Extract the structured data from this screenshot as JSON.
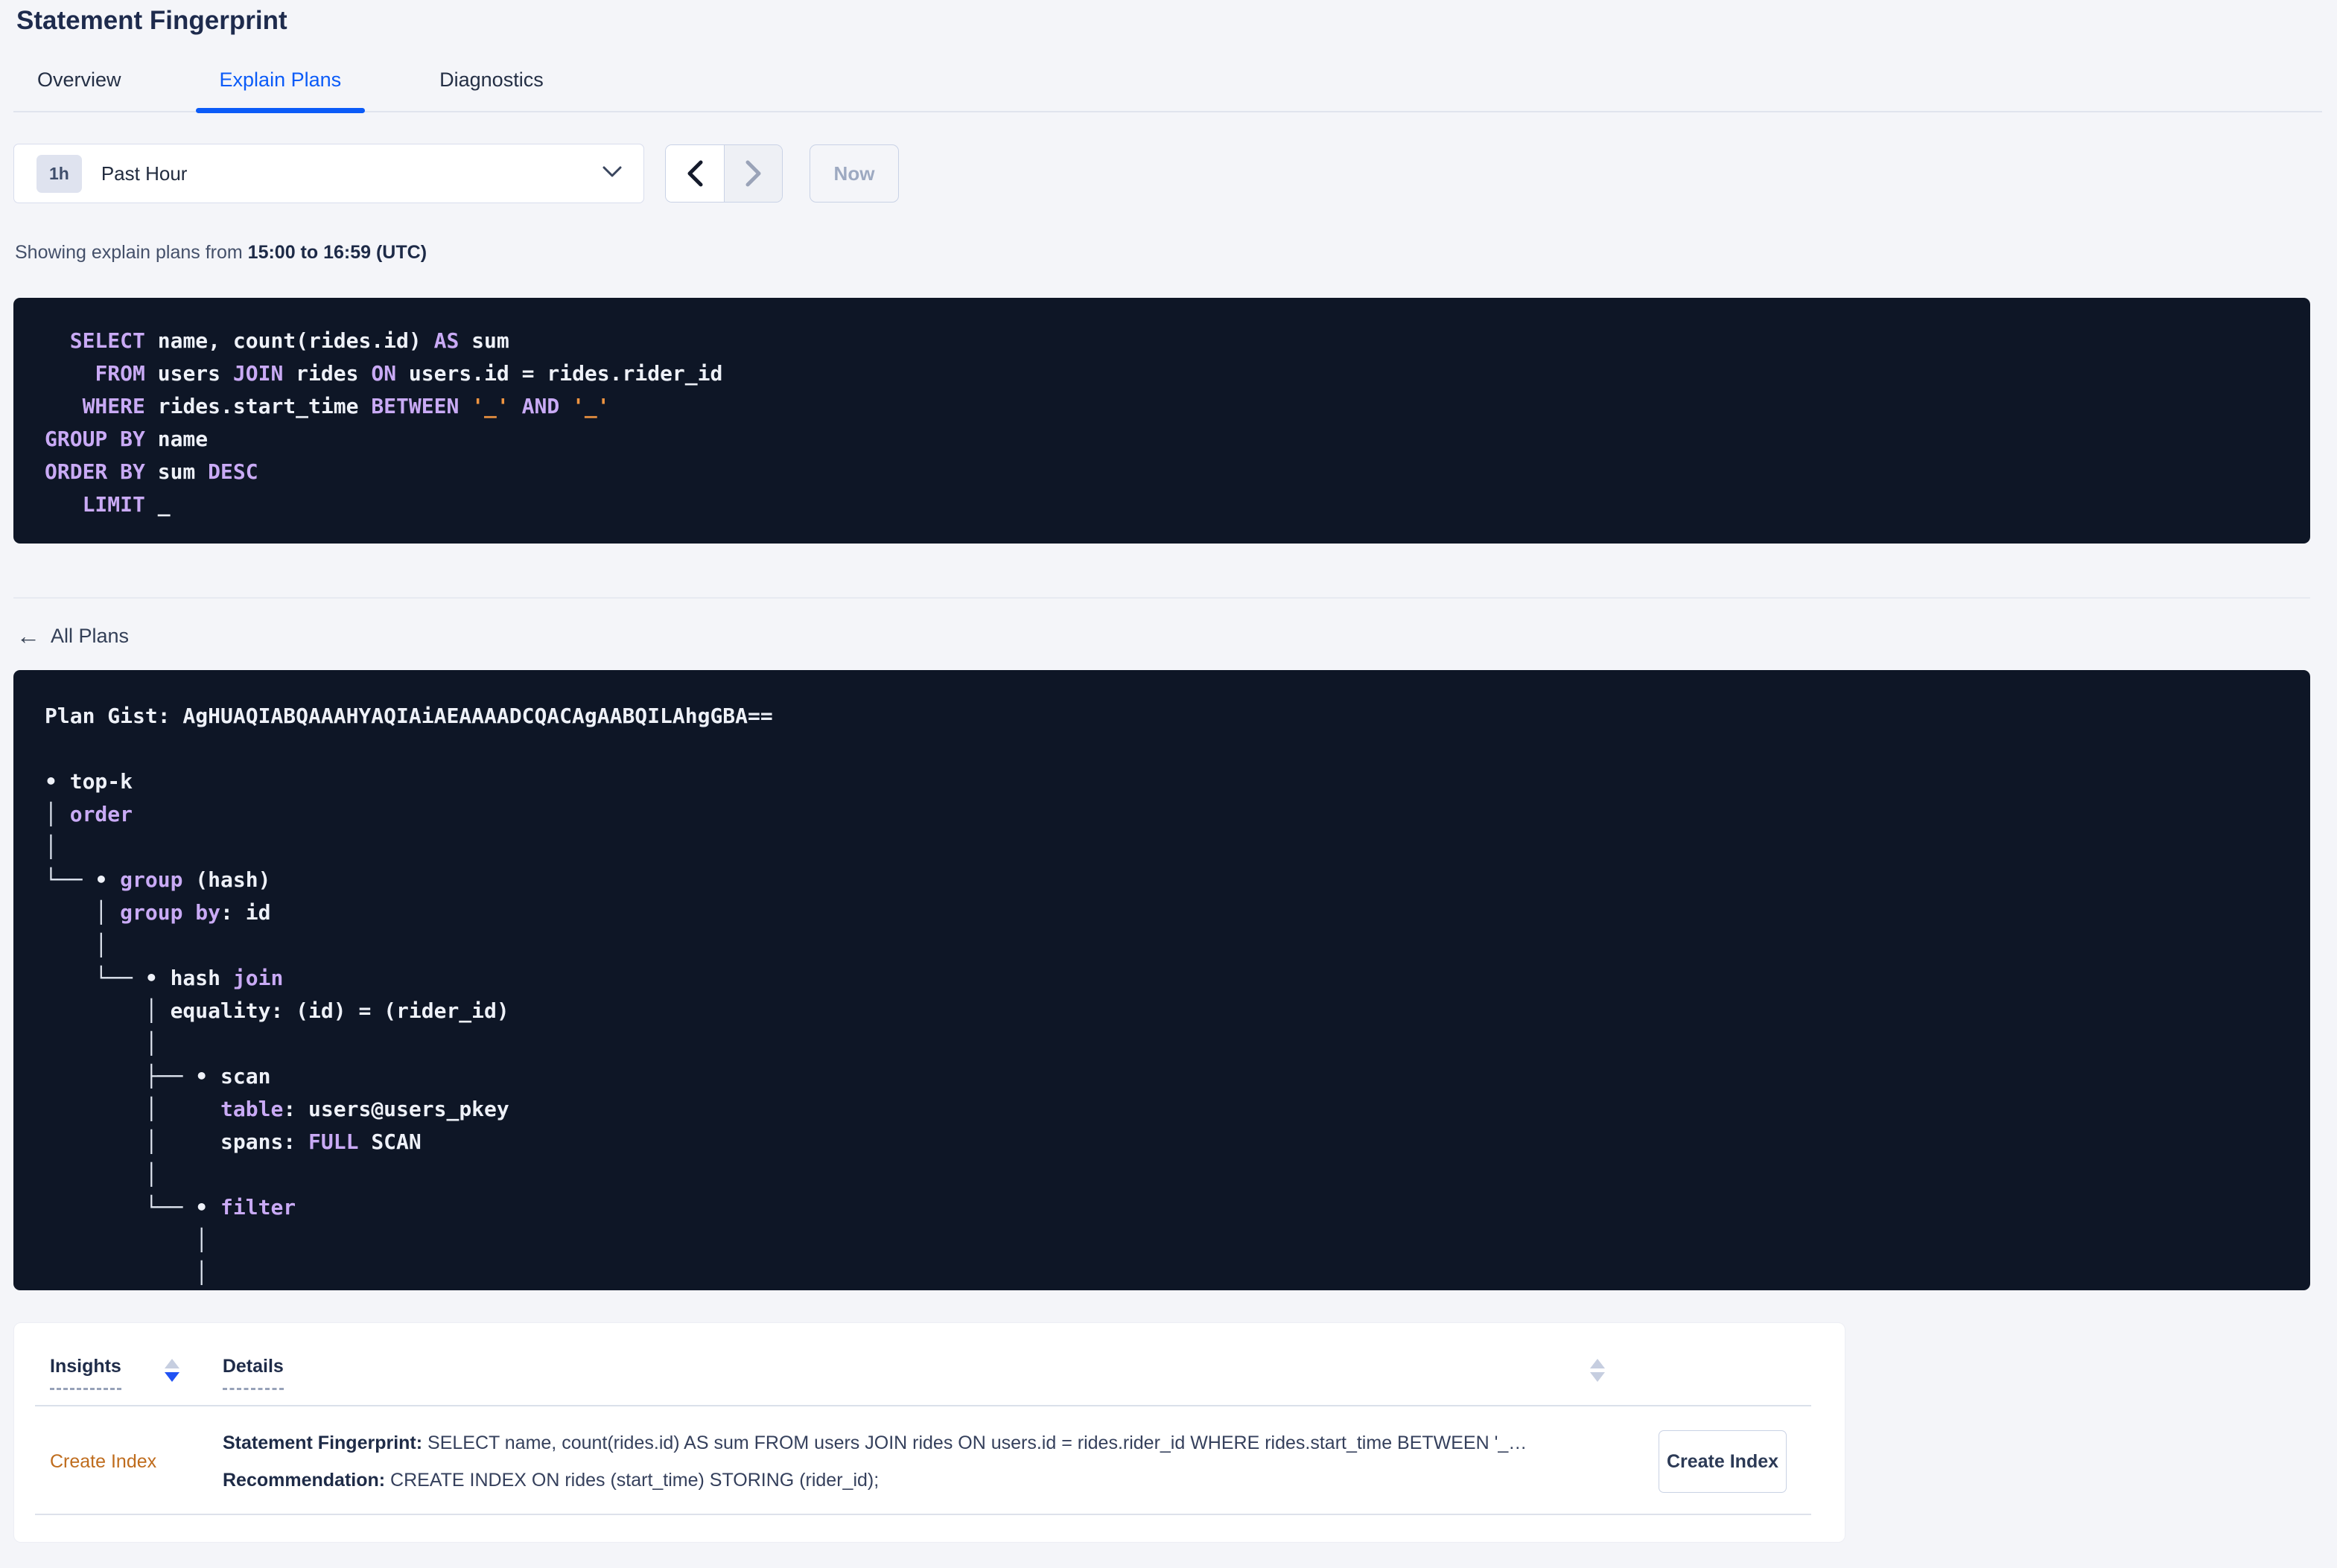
{
  "page": {
    "title": "Statement Fingerprint"
  },
  "tabs": [
    {
      "label": "Overview",
      "active": false
    },
    {
      "label": "Explain Plans",
      "active": true
    },
    {
      "label": "Diagnostics",
      "active": false
    }
  ],
  "time_selector": {
    "interval_badge": "1h",
    "selected_label": "Past Hour"
  },
  "nav": {
    "now_label": "Now"
  },
  "showing": {
    "prefix": "Showing explain plans from ",
    "range": "15:00 to 16:59 (UTC)"
  },
  "colors": {
    "accent_blue": "#0b5bf8",
    "keyword_purple": "#c9aaf5",
    "literal_orange": "#ef9440",
    "insight_orange": "#bf6c1d",
    "code_bg": "#0e1626"
  },
  "sql_block": {
    "lines": [
      [
        {
          "t": "  ",
          "c": "p"
        },
        {
          "t": "SELECT",
          "c": "k"
        },
        {
          "t": " name, count(rides.id) ",
          "c": "p"
        },
        {
          "t": "AS",
          "c": "k"
        },
        {
          "t": " sum",
          "c": "p"
        }
      ],
      [
        {
          "t": "    ",
          "c": "p"
        },
        {
          "t": "FROM",
          "c": "k"
        },
        {
          "t": " users ",
          "c": "p"
        },
        {
          "t": "JOIN",
          "c": "k"
        },
        {
          "t": " rides ",
          "c": "p"
        },
        {
          "t": "ON",
          "c": "k"
        },
        {
          "t": " users.id = rides.rider_id",
          "c": "p"
        }
      ],
      [
        {
          "t": "   ",
          "c": "p"
        },
        {
          "t": "WHERE",
          "c": "k"
        },
        {
          "t": " rides.start_time ",
          "c": "p"
        },
        {
          "t": "BETWEEN",
          "c": "k"
        },
        {
          "t": " ",
          "c": "p"
        },
        {
          "t": "'_'",
          "c": "o"
        },
        {
          "t": " ",
          "c": "p"
        },
        {
          "t": "AND",
          "c": "k"
        },
        {
          "t": " ",
          "c": "p"
        },
        {
          "t": "'_'",
          "c": "o"
        }
      ],
      [
        {
          "t": "GROUP BY",
          "c": "k"
        },
        {
          "t": " name",
          "c": "p"
        }
      ],
      [
        {
          "t": "ORDER BY",
          "c": "k"
        },
        {
          "t": " sum ",
          "c": "p"
        },
        {
          "t": "DESC",
          "c": "k"
        }
      ],
      [
        {
          "t": "   ",
          "c": "p"
        },
        {
          "t": "LIMIT",
          "c": "k"
        },
        {
          "t": " _",
          "c": "p"
        }
      ]
    ]
  },
  "all_plans": {
    "label": "All Plans",
    "arrow": "←"
  },
  "plan_block": {
    "lines": [
      [
        {
          "t": "Plan Gist: AgHUAQIABQAAAHYAQIAiAEAAAADCQACAgAABQILAhgGBA==",
          "c": "p"
        }
      ],
      [
        {
          "t": "",
          "c": "p"
        }
      ],
      [
        {
          "t": "• top-k",
          "c": "p"
        }
      ],
      [
        {
          "t": "│ ",
          "c": "t"
        },
        {
          "t": "order",
          "c": "k"
        }
      ],
      [
        {
          "t": "│",
          "c": "t"
        }
      ],
      [
        {
          "t": "└── ",
          "c": "t"
        },
        {
          "t": "• ",
          "c": "p"
        },
        {
          "t": "group",
          "c": "k"
        },
        {
          "t": " (hash)",
          "c": "p"
        }
      ],
      [
        {
          "t": "    │ ",
          "c": "t"
        },
        {
          "t": "group by",
          "c": "k"
        },
        {
          "t": ": id",
          "c": "p"
        }
      ],
      [
        {
          "t": "    │",
          "c": "t"
        }
      ],
      [
        {
          "t": "    └── ",
          "c": "t"
        },
        {
          "t": "• hash ",
          "c": "p"
        },
        {
          "t": "join",
          "c": "k"
        }
      ],
      [
        {
          "t": "        │ ",
          "c": "t"
        },
        {
          "t": "equality: (id) = (rider_id)",
          "c": "p"
        }
      ],
      [
        {
          "t": "        │",
          "c": "t"
        }
      ],
      [
        {
          "t": "        ├── ",
          "c": "t"
        },
        {
          "t": "• scan",
          "c": "p"
        }
      ],
      [
        {
          "t": "        │     ",
          "c": "t"
        },
        {
          "t": "table",
          "c": "k"
        },
        {
          "t": ": users@users_pkey",
          "c": "p"
        }
      ],
      [
        {
          "t": "        │     ",
          "c": "t"
        },
        {
          "t": "spans: ",
          "c": "p"
        },
        {
          "t": "FULL",
          "c": "k"
        },
        {
          "t": " SCAN",
          "c": "p"
        }
      ],
      [
        {
          "t": "        │",
          "c": "t"
        }
      ],
      [
        {
          "t": "        └── ",
          "c": "t"
        },
        {
          "t": "• ",
          "c": "p"
        },
        {
          "t": "filter",
          "c": "k"
        }
      ],
      [
        {
          "t": "            │",
          "c": "t"
        }
      ],
      [
        {
          "t": "            │",
          "c": "t"
        }
      ]
    ]
  },
  "insights_table": {
    "columns": [
      {
        "label": "Insights"
      },
      {
        "label": "Details"
      }
    ],
    "rows": [
      {
        "insight": "Create Index",
        "fingerprint_label": "Statement Fingerprint:",
        "fingerprint_text": " SELECT name, count(rides.id) AS sum FROM users JOIN rides ON users.id = rides.rider_id WHERE rides.start_time BETWEEN '_…",
        "recommendation_label": "Recommendation:",
        "recommendation_text": " CREATE INDEX ON rides (start_time) STORING (rider_id);",
        "action_label": "Create Index"
      }
    ]
  }
}
